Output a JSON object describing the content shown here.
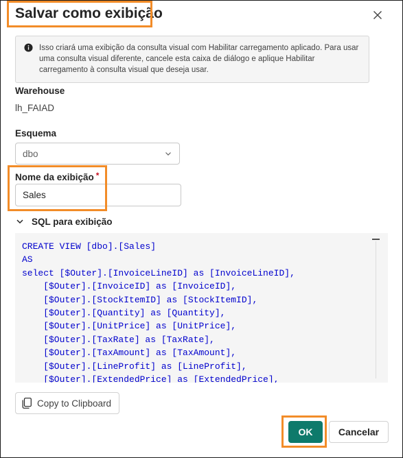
{
  "dialog": {
    "title": "Salvar como exibição",
    "info_text": "Isso criará uma exibição da consulta visual com Habilitar carregamento aplicado. Para usar uma consulta visual diferente, cancele esta caixa de diálogo e aplique Habilitar carregamento à consulta visual que deseja usar."
  },
  "warehouse": {
    "label": "Warehouse",
    "value": "lh_FAIAD"
  },
  "schema": {
    "label": "Esquema",
    "selected": "dbo"
  },
  "view_name": {
    "label": "Nome da exibição",
    "required_mark": "*",
    "value": "Sales"
  },
  "sql": {
    "toggle_label": "SQL para exibição",
    "lines": [
      "CREATE VIEW [dbo].[Sales]",
      "AS",
      "select [$Outer].[InvoiceLineID] as [InvoiceLineID],",
      "    [$Outer].[InvoiceID] as [InvoiceID],",
      "    [$Outer].[StockItemID] as [StockItemID],",
      "    [$Outer].[Quantity] as [Quantity],",
      "    [$Outer].[UnitPrice] as [UnitPrice],",
      "    [$Outer].[TaxRate] as [TaxRate],",
      "    [$Outer].[TaxAmount] as [TaxAmount],",
      "    [$Outer].[LineProfit] as [LineProfit],",
      "    [$Outer].[ExtendedPrice] as [ExtendedPrice],"
    ]
  },
  "actions": {
    "copy_label": "Copy to Clipboard",
    "ok_label": "OK",
    "cancel_label": "Cancelar"
  },
  "colors": {
    "highlight": "#f28c28",
    "primary": "#0e7a6b",
    "code_text": "#0000cd"
  },
  "icons": {
    "close": "close-icon",
    "info": "info-icon",
    "chevron": "chevron-down-icon",
    "copy": "copy-icon"
  }
}
